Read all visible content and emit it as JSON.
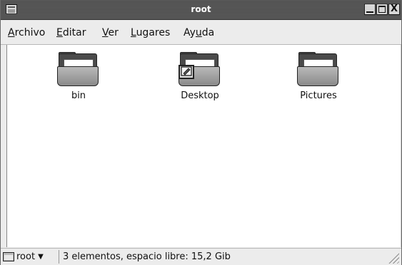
{
  "window": {
    "title": "root",
    "buttons": {
      "minimize": "_",
      "maximize": "□",
      "close": "X"
    }
  },
  "menubar": {
    "items": [
      {
        "mnemonic": "A",
        "rest": "rchivo"
      },
      {
        "mnemonic": "E",
        "rest": "ditar"
      },
      {
        "mnemonic": "V",
        "rest": "er"
      },
      {
        "mnemonic": "L",
        "rest": "ugares"
      },
      {
        "pre": "Ay",
        "mnemonic": "u",
        "rest": "da"
      }
    ]
  },
  "files": [
    {
      "name": "bin",
      "icon": "folder-icon"
    },
    {
      "name": "Desktop",
      "icon": "folder-icon",
      "emblem": "desktop-emblem-icon"
    },
    {
      "name": "Pictures",
      "icon": "folder-icon"
    }
  ],
  "statusbar": {
    "location": "root",
    "summary": "3 elementos, espacio libre: 15,2 Gib"
  },
  "colors": {
    "titlebar": "#5a5a5a",
    "content_bg": "#ffffff",
    "chrome_bg": "#ececec"
  }
}
